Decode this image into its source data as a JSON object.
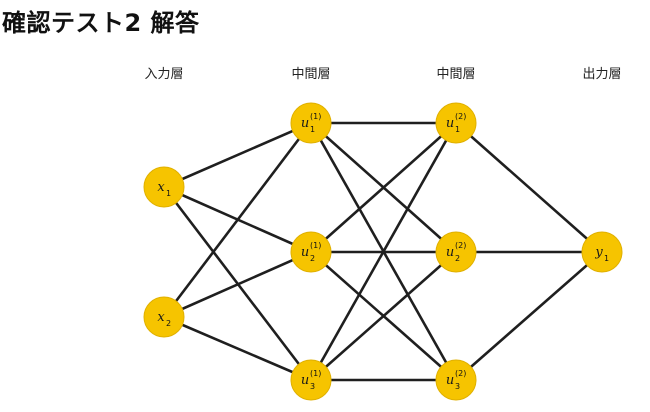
{
  "title": "確認テスト2 解答",
  "layers": [
    {
      "label": "入力層"
    },
    {
      "label": "中間層"
    },
    {
      "label": "中間層"
    },
    {
      "label": "出力層"
    }
  ],
  "nodes": {
    "x1": {
      "main": "x",
      "sub": "1",
      "sup": ""
    },
    "x2": {
      "main": "x",
      "sub": "2",
      "sup": ""
    },
    "u1_1": {
      "main": "u",
      "sub": "1",
      "sup": "(1)"
    },
    "u2_1": {
      "main": "u",
      "sub": "2",
      "sup": "(1)"
    },
    "u3_1": {
      "main": "u",
      "sub": "3",
      "sup": "(1)"
    },
    "u1_2": {
      "main": "u",
      "sub": "1",
      "sup": "(2)"
    },
    "u2_2": {
      "main": "u",
      "sub": "2",
      "sup": "(2)"
    },
    "u3_2": {
      "main": "u",
      "sub": "3",
      "sup": "(2)"
    },
    "y1": {
      "main": "y",
      "sub": "1",
      "sup": ""
    }
  },
  "colors": {
    "node_fill": "#f6c400",
    "node_stroke": "#e0b000",
    "edge": "#1f1f1f",
    "text": "#111111"
  }
}
